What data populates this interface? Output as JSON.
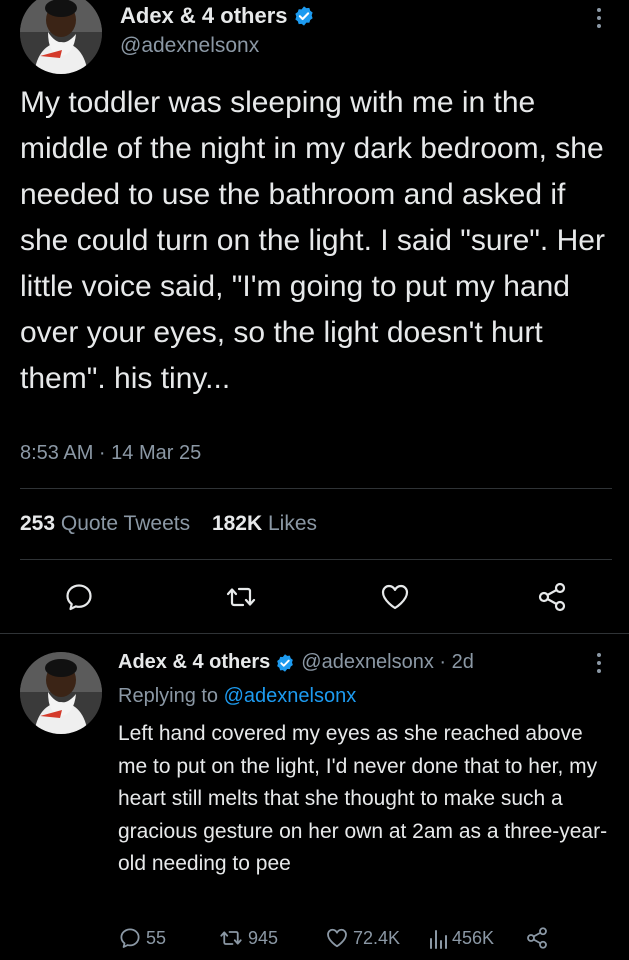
{
  "main_tweet": {
    "author_name": "Adex & 4 others",
    "handle": "@adexnelsonx",
    "text": "My toddler was sleeping with me in the middle of the night in my dark bedroom, she needed to use the bathroom and asked if she could turn on the light. I said \"sure\". Her little voice said, \"I'm going to put my hand over your eyes, so the light doesn't hurt them\".  his tiny...",
    "timestamp": "8:53 AM · 14 Mar 25",
    "quote_tweets_count": "253",
    "quote_tweets_label": "Quote Tweets",
    "likes_count": "182K",
    "likes_label": "Likes"
  },
  "reply_tweet": {
    "author_name": "Adex & 4 others",
    "handle_time": "@adexnelsonx · 2d",
    "replying_prefix": "Replying to",
    "replying_handle": "@adexnelsonx",
    "text": "Left hand covered my eyes as she reached above me to put on the light, I'd never done that to her, my heart still melts that she thought to make such a gracious gesture on her own at 2am as a three-year-old needing to pee",
    "reply_count": "55",
    "retweet_count": "945",
    "like_count": "72.4K",
    "view_count": "456K"
  },
  "icons": {
    "verified": "verified-badge-icon",
    "more": "more-vertical-icon",
    "reply": "reply-icon",
    "retweet": "retweet-icon",
    "like": "heart-icon",
    "share": "share-icon",
    "views": "views-icon"
  },
  "colors": {
    "background": "#000000",
    "text": "#e7e9ea",
    "secondary_text": "#8b98a5",
    "accent": "#1d9bf0",
    "divider": "#2f3336"
  }
}
